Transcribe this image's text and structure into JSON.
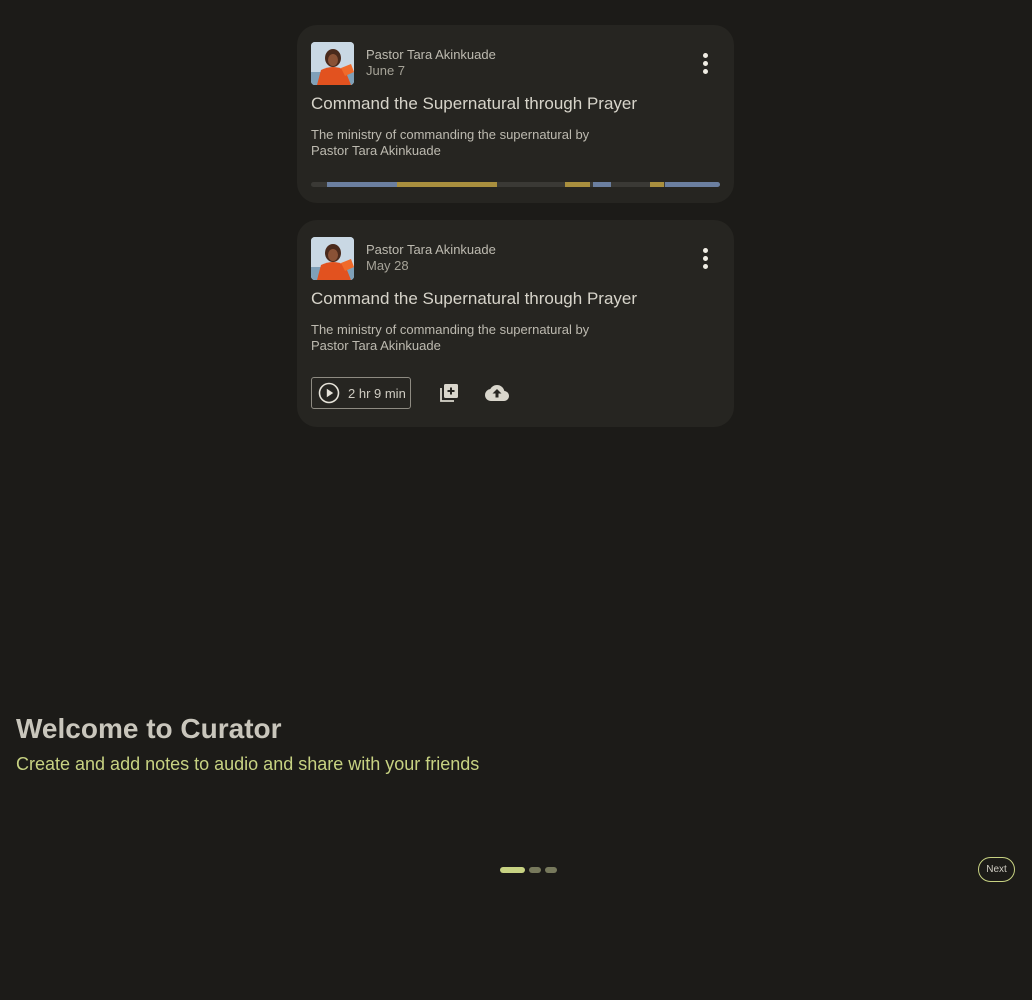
{
  "colors": {
    "background": "#1c1b18",
    "card": "#262521",
    "accent": "#c7d282",
    "progress_blue": "#6b7fa0",
    "progress_gold": "#a98f3e"
  },
  "cards": [
    {
      "author": "Pastor Tara Akinkuade",
      "date": "June 7",
      "title": "Command the Supernatural through Prayer",
      "description": "The ministry of commanding the supernatural by Pastor Tara Akinkuade",
      "avatar_icon": "person-photo",
      "menu_icon": "more-vertical-icon",
      "note_segments": [
        {
          "color": "blue",
          "from": 0.04,
          "to": 0.21
        },
        {
          "color": "gold",
          "from": 0.21,
          "to": 0.455
        },
        {
          "color": "gold",
          "from": 0.62,
          "to": 0.68
        },
        {
          "color": "blue",
          "from": 0.69,
          "to": 0.735
        },
        {
          "color": "gold",
          "from": 0.83,
          "to": 0.865
        },
        {
          "color": "blue",
          "from": 0.865,
          "to": 1.0
        }
      ]
    },
    {
      "author": "Pastor Tara Akinkuade",
      "date": "May 28",
      "title": "Command the Supernatural through Prayer",
      "description": "The ministry of commanding the supernatural by Pastor Tara Akinkuade",
      "avatar_icon": "person-photo",
      "menu_icon": "more-vertical-icon",
      "duration": "2 hr 9 min",
      "play_icon": "play-circle-icon",
      "add_icon": "library-add-icon",
      "upload_icon": "cloud-upload-icon"
    }
  ],
  "onboarding": {
    "title": "Welcome to Curator",
    "subtitle": "Create and add notes to audio and share with your friends",
    "pages": 3,
    "current_page": 1,
    "next_label": "Next"
  }
}
